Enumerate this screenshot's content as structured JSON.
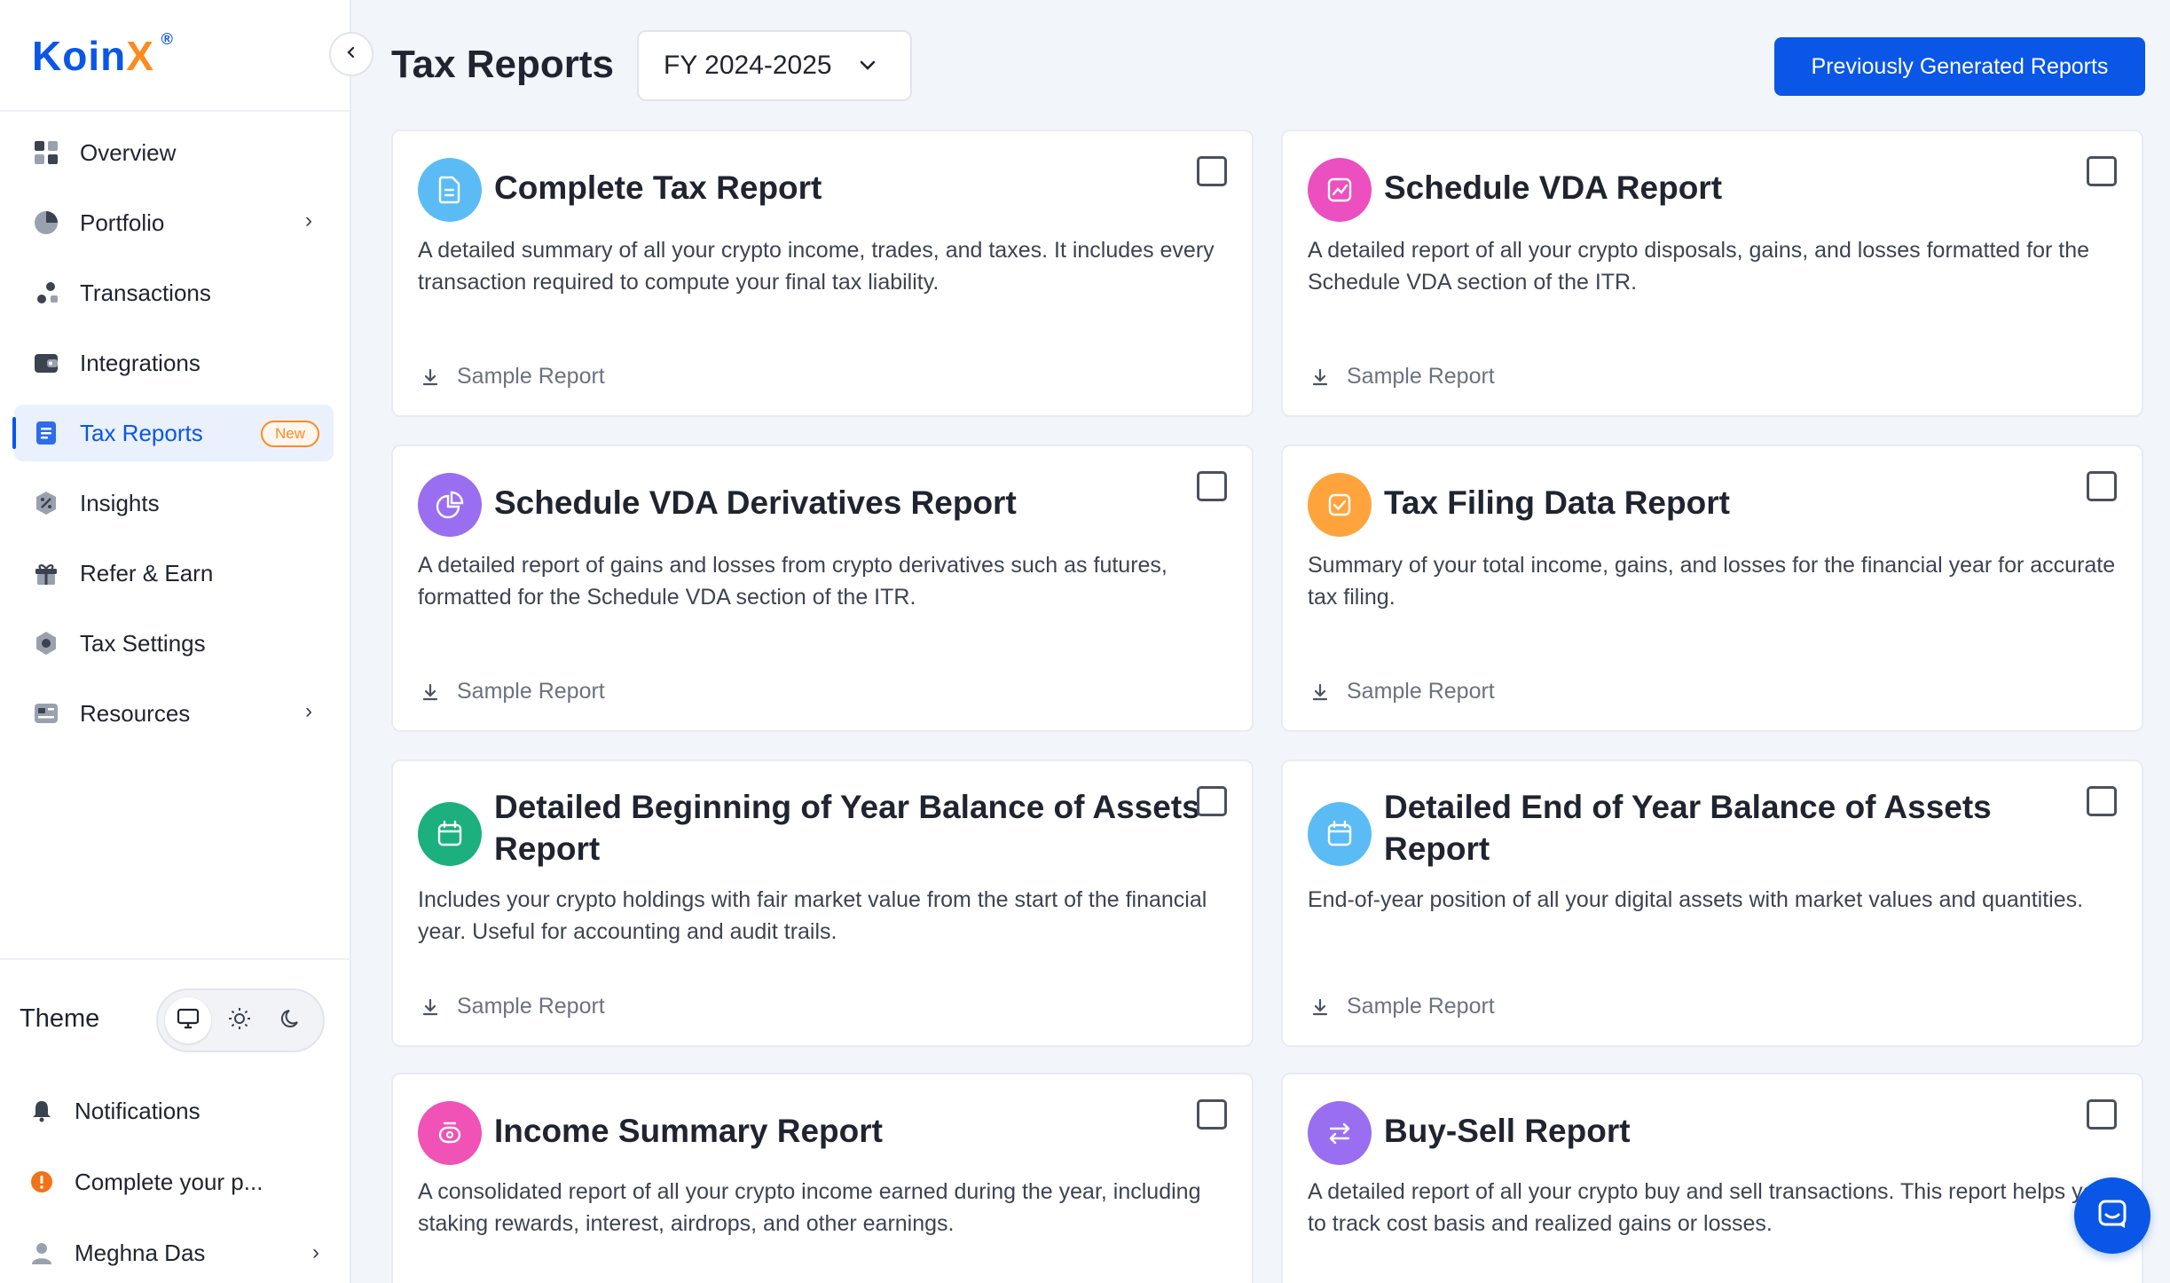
{
  "brand": {
    "name_a": "Koin",
    "name_b": "X",
    "reg": "®"
  },
  "nav": [
    {
      "label": "Overview",
      "icon": "grid-icon"
    },
    {
      "label": "Portfolio",
      "icon": "pie-icon",
      "has_chevron": true
    },
    {
      "label": "Transactions",
      "icon": "transfer-icon"
    },
    {
      "label": "Integrations",
      "icon": "wallet-icon"
    },
    {
      "label": "Tax Reports",
      "icon": "document-icon",
      "active": true,
      "badge": "New"
    },
    {
      "label": "Insights",
      "icon": "insights-icon"
    },
    {
      "label": "Refer & Earn",
      "icon": "gift-icon"
    },
    {
      "label": "Tax Settings",
      "icon": "gear-icon"
    },
    {
      "label": "Resources",
      "icon": "resources-icon",
      "has_chevron": true
    }
  ],
  "theme": {
    "label": "Theme",
    "selected": "system"
  },
  "bottom": {
    "notifications": "Notifications",
    "complete_profile": "Complete your p...",
    "user": "Meghna Das"
  },
  "header": {
    "title": "Tax Reports",
    "fy_selected": "FY 2024-2025",
    "prev_button": "Previously Generated Reports"
  },
  "sample_label": "Sample Report",
  "cards": [
    {
      "title": "Complete Tax Report",
      "desc": "A detailed summary of all your crypto income, trades, and taxes. It includes every transaction required to compute your final tax liability.",
      "icon": "document-icon",
      "color": "#5bbcf5"
    },
    {
      "title": "Schedule VDA Report",
      "desc": "A detailed report of all your crypto disposals, gains, and losses formatted for the Schedule VDA section of the ITR.",
      "icon": "chart-icon",
      "color": "#ec4fc0"
    },
    {
      "title": "Schedule VDA Derivatives Report",
      "desc": "A detailed report of gains and losses from crypto derivatives such as futures, formatted for the Schedule VDA section of the ITR.",
      "icon": "pie-icon",
      "color": "#9a6ef0"
    },
    {
      "title": "Tax Filing Data Report",
      "desc": "Summary of your total income, gains, and losses for the financial year for accurate tax filing.",
      "icon": "check-icon",
      "color": "#ffa43d"
    },
    {
      "title": "Detailed Beginning of Year Balance of Assets Report",
      "desc": "Includes your crypto holdings with fair market value from the start of the financial year. Useful for accounting and audit trails.",
      "icon": "calendar-icon",
      "color": "#1bb07e"
    },
    {
      "title": "Detailed End of Year Balance of Assets Report",
      "desc": "End-of-year position of all your digital assets with market values and quantities.",
      "icon": "calendar-icon",
      "color": "#5bbcf5"
    },
    {
      "title": "Income Summary Report",
      "desc": "A consolidated report of all your crypto income earned during the year, including staking rewards, interest, airdrops, and other earnings.",
      "icon": "money-icon",
      "color": "#f052b5"
    },
    {
      "title": "Buy-Sell Report",
      "desc": "A detailed report of all your crypto buy and sell transactions. This report helps you to track cost basis and realized gains or losses.",
      "icon": "swap-icon",
      "color": "#9a6ef0"
    }
  ]
}
